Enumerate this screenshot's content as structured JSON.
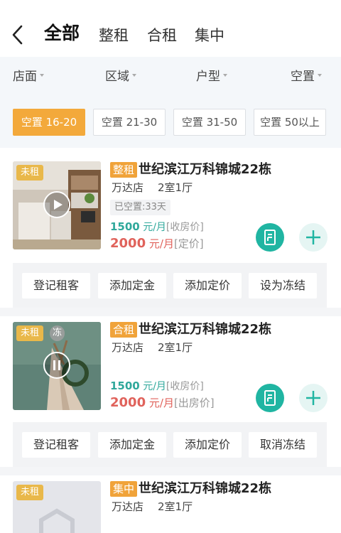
{
  "nav": {
    "tabs": [
      "全部",
      "整租",
      "合租",
      "集中"
    ]
  },
  "filters": [
    "店面",
    "区域",
    "户型",
    "空置"
  ],
  "vacancy_chips": [
    "空置 16-20",
    "空置 21-30",
    "空置 31-50",
    "空置 50以上"
  ],
  "colors": {
    "accent_orange": "#f3a93b",
    "teal": "#20b5a2",
    "price_green": "#2fa89b",
    "price_red": "#e0625b"
  },
  "listings": [
    {
      "status_badge": "未租",
      "type_tag": "整租",
      "title": "世纪滨江万科锦城22栋",
      "store": "万达店",
      "rooms": "2室1厅",
      "vacant": "已空置:33天",
      "price1_num": "1500",
      "price1_unit": "元/月",
      "price1_label": "[收房价]",
      "price2_num": "2000",
      "price2_unit": "元/月",
      "price2_label": "[定价]",
      "actions": [
        "登记租客",
        "添加定金",
        "添加定价",
        "设为冻结"
      ]
    },
    {
      "status_badge": "未租",
      "freeze_badge": "冻",
      "type_tag": "合租",
      "title": "世纪滨江万科锦城22栋",
      "store": "万达店",
      "rooms": "2室1厅",
      "price1_num": "1500",
      "price1_unit": "元/月",
      "price1_label": "[收房价]",
      "price2_num": "2000",
      "price2_unit": "元/月",
      "price2_label": "[出房价]",
      "actions": [
        "登记租客",
        "添加定金",
        "添加定价",
        "取消冻结"
      ]
    },
    {
      "status_badge": "未租",
      "type_tag": "集中",
      "title": "世纪滨江万科锦城22栋",
      "store": "万达店",
      "rooms": "2室1厅"
    }
  ]
}
